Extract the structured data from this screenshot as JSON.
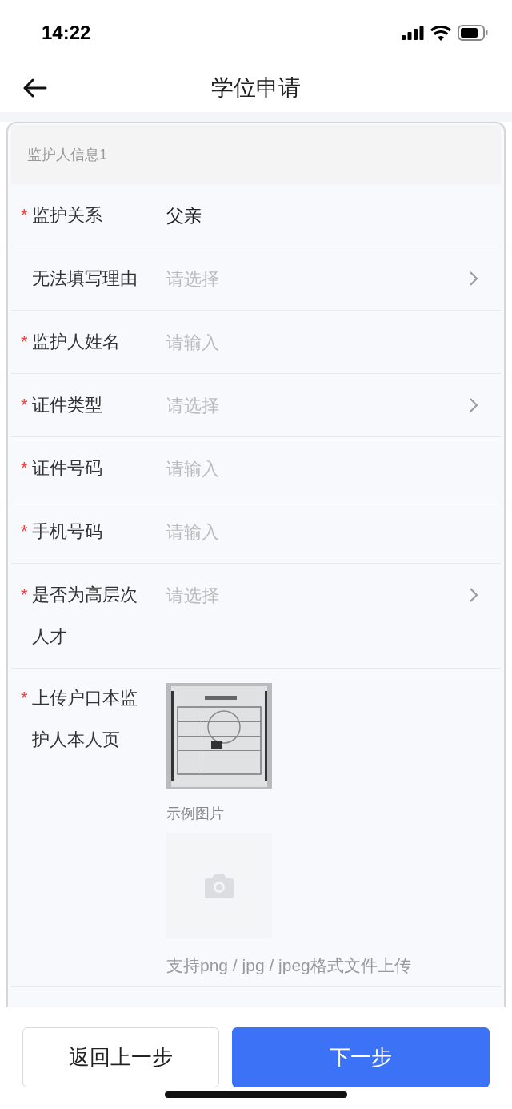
{
  "status_bar": {
    "time": "14:22"
  },
  "header": {
    "title": "学位申请"
  },
  "section": {
    "title": "监护人信息1"
  },
  "fields": [
    {
      "kind": "display",
      "label": "监护关系",
      "required_mark": "*",
      "value": "父亲"
    },
    {
      "kind": "select",
      "label": "无法填写理由",
      "placeholder": "请选择"
    },
    {
      "kind": "input",
      "label": "监护人姓名",
      "required_mark": "*",
      "placeholder": "请输入"
    },
    {
      "kind": "select",
      "label": "证件类型",
      "required_mark": "*",
      "placeholder": "请选择"
    },
    {
      "kind": "input",
      "label": "证件号码",
      "required_mark": "*",
      "placeholder": "请输入"
    },
    {
      "kind": "input",
      "label": "手机号码",
      "required_mark": "*",
      "placeholder": "请输入"
    },
    {
      "kind": "select",
      "label": "是否为高层次人才",
      "required_mark": "*",
      "placeholder": "请选择"
    },
    {
      "kind": "upload",
      "label": "上传户口本监护人本人页",
      "required_mark": "*",
      "example_caption": "示例图片",
      "hint": "支持png / jpg / jpeg格式文件上传"
    }
  ],
  "buttons": [
    {
      "label": "返回上一步",
      "kind": "secondary"
    },
    {
      "label": "下一步",
      "kind": "primary"
    }
  ]
}
